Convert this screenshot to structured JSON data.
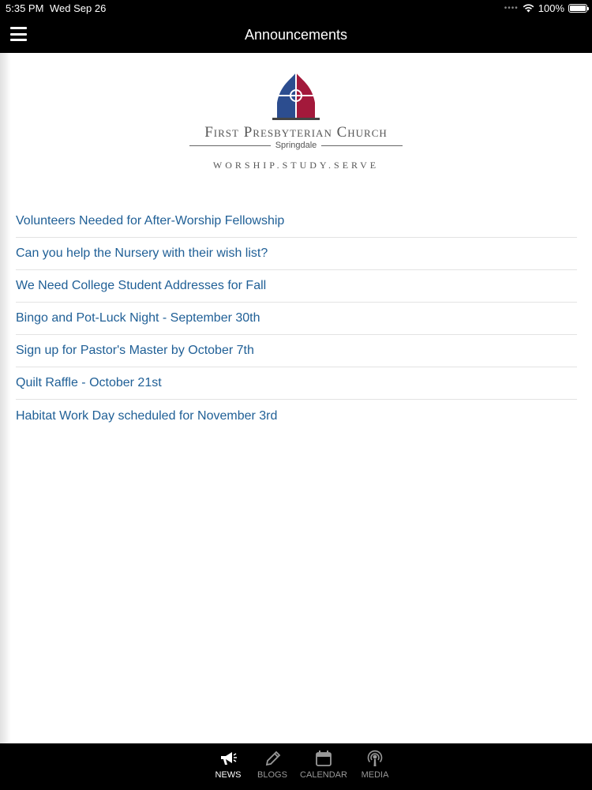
{
  "status": {
    "time": "5:35 PM",
    "date": "Wed Sep 26",
    "battery": "100%"
  },
  "nav": {
    "title": "Announcements"
  },
  "logo": {
    "church_name": "First Presbyterian Church",
    "town": "Springdale",
    "motto": "WORSHIP.STUDY.SERVE"
  },
  "announcements": [
    {
      "title": "Volunteers Needed for After-Worship Fellowship"
    },
    {
      "title": "Can you help the Nursery with their wish list?"
    },
    {
      "title": "We Need College Student Addresses for Fall"
    },
    {
      "title": "Bingo and Pot-Luck Night - September 30th"
    },
    {
      "title": "Sign up for Pastor's Master by October 7th"
    },
    {
      "title": "Quilt Raffle - October 21st"
    },
    {
      "title": "Habitat Work Day scheduled for November 3rd"
    }
  ],
  "tabs": [
    {
      "label": "NEWS",
      "icon": "megaphone-icon",
      "active": true
    },
    {
      "label": "BLOGS",
      "icon": "pencil-icon",
      "active": false
    },
    {
      "label": "CALENDAR",
      "icon": "calendar-icon",
      "active": false
    },
    {
      "label": "MEDIA",
      "icon": "podcast-icon",
      "active": false
    }
  ],
  "colors": {
    "link": "#1f5f96",
    "bar": "#000000",
    "emblem_red": "#a3193b",
    "emblem_blue": "#2c4d8f"
  }
}
